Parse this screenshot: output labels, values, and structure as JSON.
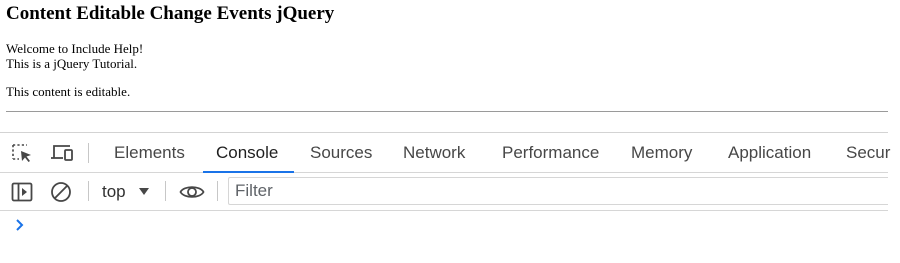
{
  "page": {
    "title": "Content Editable Change Events jQuery",
    "line1": "Welcome to Include Help!",
    "line2": "This is a jQuery Tutorial.",
    "editable_text": "This content is editable."
  },
  "devtools": {
    "icons": {
      "inspect": "inspect-element-icon",
      "device": "device-toolbar-icon",
      "sidebar": "show-console-sidebar-icon",
      "clear": "clear-console-icon",
      "dropdown": "dropdown-arrow-icon",
      "eye": "live-expression-eye-icon",
      "prompt": "console-prompt-chevron-icon"
    },
    "tabs": [
      {
        "label": "Elements",
        "active": false
      },
      {
        "label": "Console",
        "active": true
      },
      {
        "label": "Sources",
        "active": false
      },
      {
        "label": "Network",
        "active": false
      },
      {
        "label": "Performance",
        "active": false
      },
      {
        "label": "Memory",
        "active": false
      },
      {
        "label": "Application",
        "active": false
      },
      {
        "label": "Secur",
        "active": false
      }
    ],
    "console_toolbar": {
      "context": "top",
      "filter_placeholder": "Filter",
      "filter_value": ""
    },
    "colors": {
      "accent": "#1a73e8",
      "icon": "#474747"
    }
  }
}
